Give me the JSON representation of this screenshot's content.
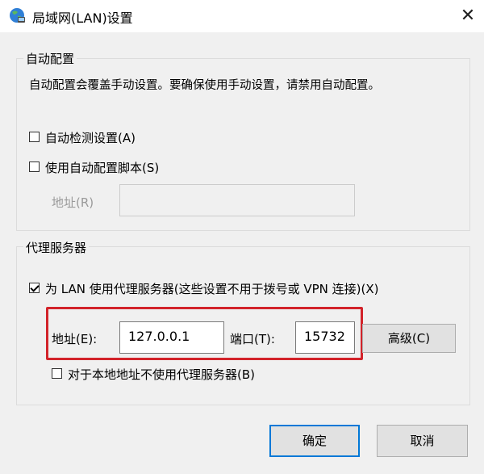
{
  "window": {
    "title": "局域网(LAN)设置",
    "close_glyph": "✕"
  },
  "auto_config": {
    "group_title": "自动配置",
    "description": "自动配置会覆盖手动设置。要确保使用手动设置，请禁用自动配置。",
    "auto_detect_label": "自动检测设置(A)",
    "auto_detect_checked": false,
    "use_script_label": "使用自动配置脚本(S)",
    "use_script_checked": false,
    "address_label": "地址(R)",
    "address_value": ""
  },
  "proxy": {
    "group_title": "代理服务器",
    "use_proxy_label": "为 LAN 使用代理服务器(这些设置不用于拨号或 VPN 连接)(X)",
    "use_proxy_checked": true,
    "address_label": "地址(E):",
    "address_value": "127.0.0.1",
    "port_label": "端口(T):",
    "port_value": "15732",
    "advanced_label": "高级(C)",
    "bypass_label": "对于本地地址不使用代理服务器(B)",
    "bypass_checked": false
  },
  "buttons": {
    "ok_label": "确定",
    "cancel_label": "取消"
  },
  "colors": {
    "highlight_box": "#d2232a",
    "default_button_border": "#0078d7"
  },
  "icons": {
    "title": "globe-network-icon",
    "close": "close-icon"
  }
}
